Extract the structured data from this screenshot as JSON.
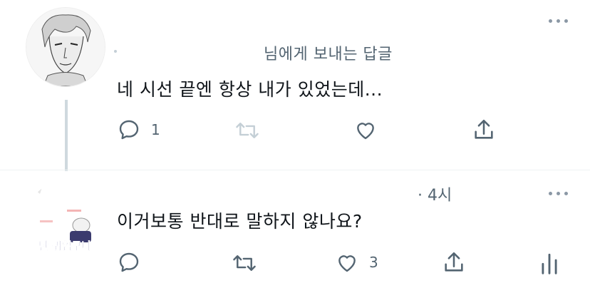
{
  "tweet1": {
    "reply_to": "님에게 보내는 답글",
    "text": "네 시선 끝엔 항상 내가 있었는데...",
    "reply_count": "1",
    "icons": [
      "reply-icon",
      "retweet-icon",
      "like-icon",
      "share-icon"
    ]
  },
  "tweet2": {
    "time": "· 4시",
    "text": "이거보통 반대로 말하지 않나요?",
    "like_count": "3",
    "icons": [
      "reply-icon",
      "retweet-icon",
      "like-icon",
      "share-icon",
      "analytics-icon"
    ]
  },
  "colors": {
    "text": "#0f1419",
    "muted": "#536471",
    "thread_line": "#cfd9de",
    "retweet_disabled": "#c4cfd6"
  }
}
